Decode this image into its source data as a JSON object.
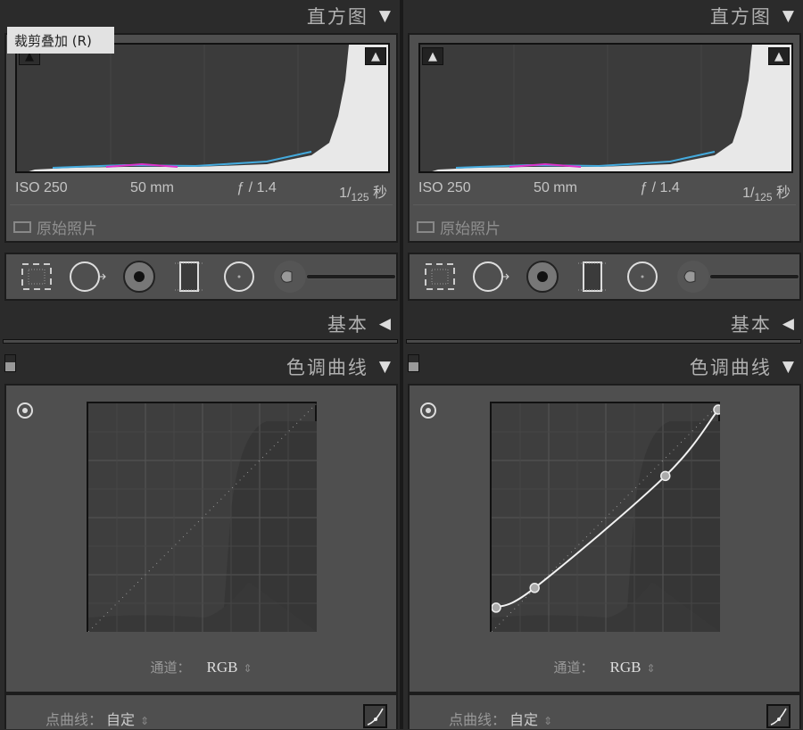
{
  "tooltip": "裁剪叠加 (R)",
  "panels": [
    {
      "histogram_title": "直方图",
      "iso": "ISO 250",
      "focal": "50 mm",
      "aperture": "ƒ / 1.4",
      "shutter_num": "1/",
      "shutter_den": "125",
      "shutter_unit": "秒",
      "original_photo": "原始照片",
      "basic_title": "基本",
      "tone_curve_title": "色调曲线",
      "channel_label": "通道：",
      "channel_value": "RGB",
      "point_curve_label": "点曲线：",
      "point_curve_value": "自定",
      "curve_points": [
        [
          0,
          0
        ],
        [
          255,
          255
        ]
      ],
      "shadow_clip_on": false,
      "highlight_clip_on": true
    },
    {
      "histogram_title": "直方图",
      "iso": "ISO 250",
      "focal": "50 mm",
      "aperture": "ƒ / 1.4",
      "shutter_num": "1/",
      "shutter_den": "125",
      "shutter_unit": "秒",
      "original_photo": "原始照片",
      "basic_title": "基本",
      "tone_curve_title": "色调曲线",
      "channel_label": "通道：",
      "channel_value": "RGB",
      "point_curve_label": "点曲线：",
      "point_curve_value": "自定",
      "curve_points": [
        [
          5,
          27
        ],
        [
          48,
          49
        ],
        [
          194,
          174
        ],
        [
          253,
          248
        ]
      ],
      "shadow_clip_on": true,
      "highlight_clip_on": true
    }
  ],
  "colors": {
    "accent": "#ffffff",
    "panel": "#4f4f4f",
    "header": "#2b2b2b"
  }
}
